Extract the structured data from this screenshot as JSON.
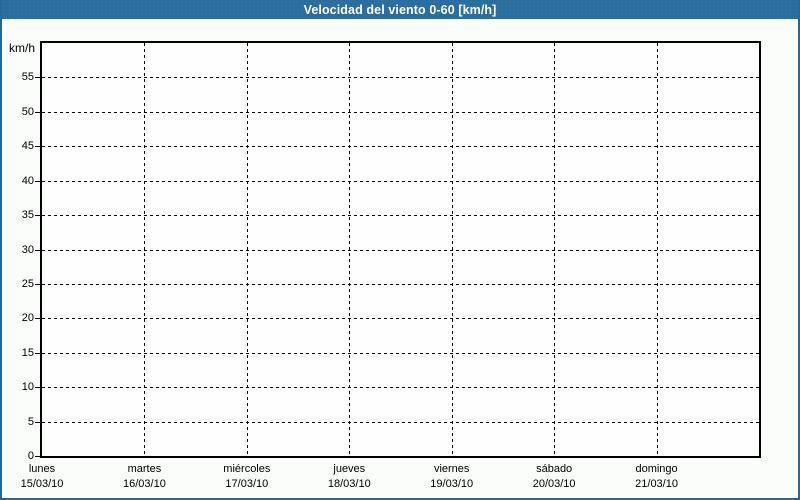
{
  "header": {
    "title": "Velocidad del viento 0-60 [km/h]"
  },
  "chart_data": {
    "type": "line",
    "title": "Velocidad del viento 0-60 [km/h]",
    "ylabel": "km/h",
    "xlabel": "",
    "ylim": [
      0,
      60
    ],
    "y_ticks": [
      0,
      5,
      10,
      15,
      20,
      25,
      30,
      35,
      40,
      45,
      50,
      55
    ],
    "x_divisions": 7,
    "x_categories": [
      {
        "day": "lunes",
        "date": "15/03/10"
      },
      {
        "day": "martes",
        "date": "16/03/10"
      },
      {
        "day": "miércoles",
        "date": "17/03/10"
      },
      {
        "day": "jueves",
        "date": "18/03/10"
      },
      {
        "day": "viernes",
        "date": "19/03/10"
      },
      {
        "day": "sábado",
        "date": "20/03/10"
      },
      {
        "day": "domingo",
        "date": "21/03/10"
      }
    ],
    "series": [],
    "grid": "dashed",
    "legend": "none"
  },
  "colors": {
    "titlebar_bg": "#2a6d9e",
    "titlebar_text": "#ffffff",
    "frame_border": "#26689b",
    "page_bg": "#fbfdfb",
    "plot_bg": "#fdfefd",
    "axis": "#000000",
    "grid": "#000000",
    "text": "#000000"
  }
}
